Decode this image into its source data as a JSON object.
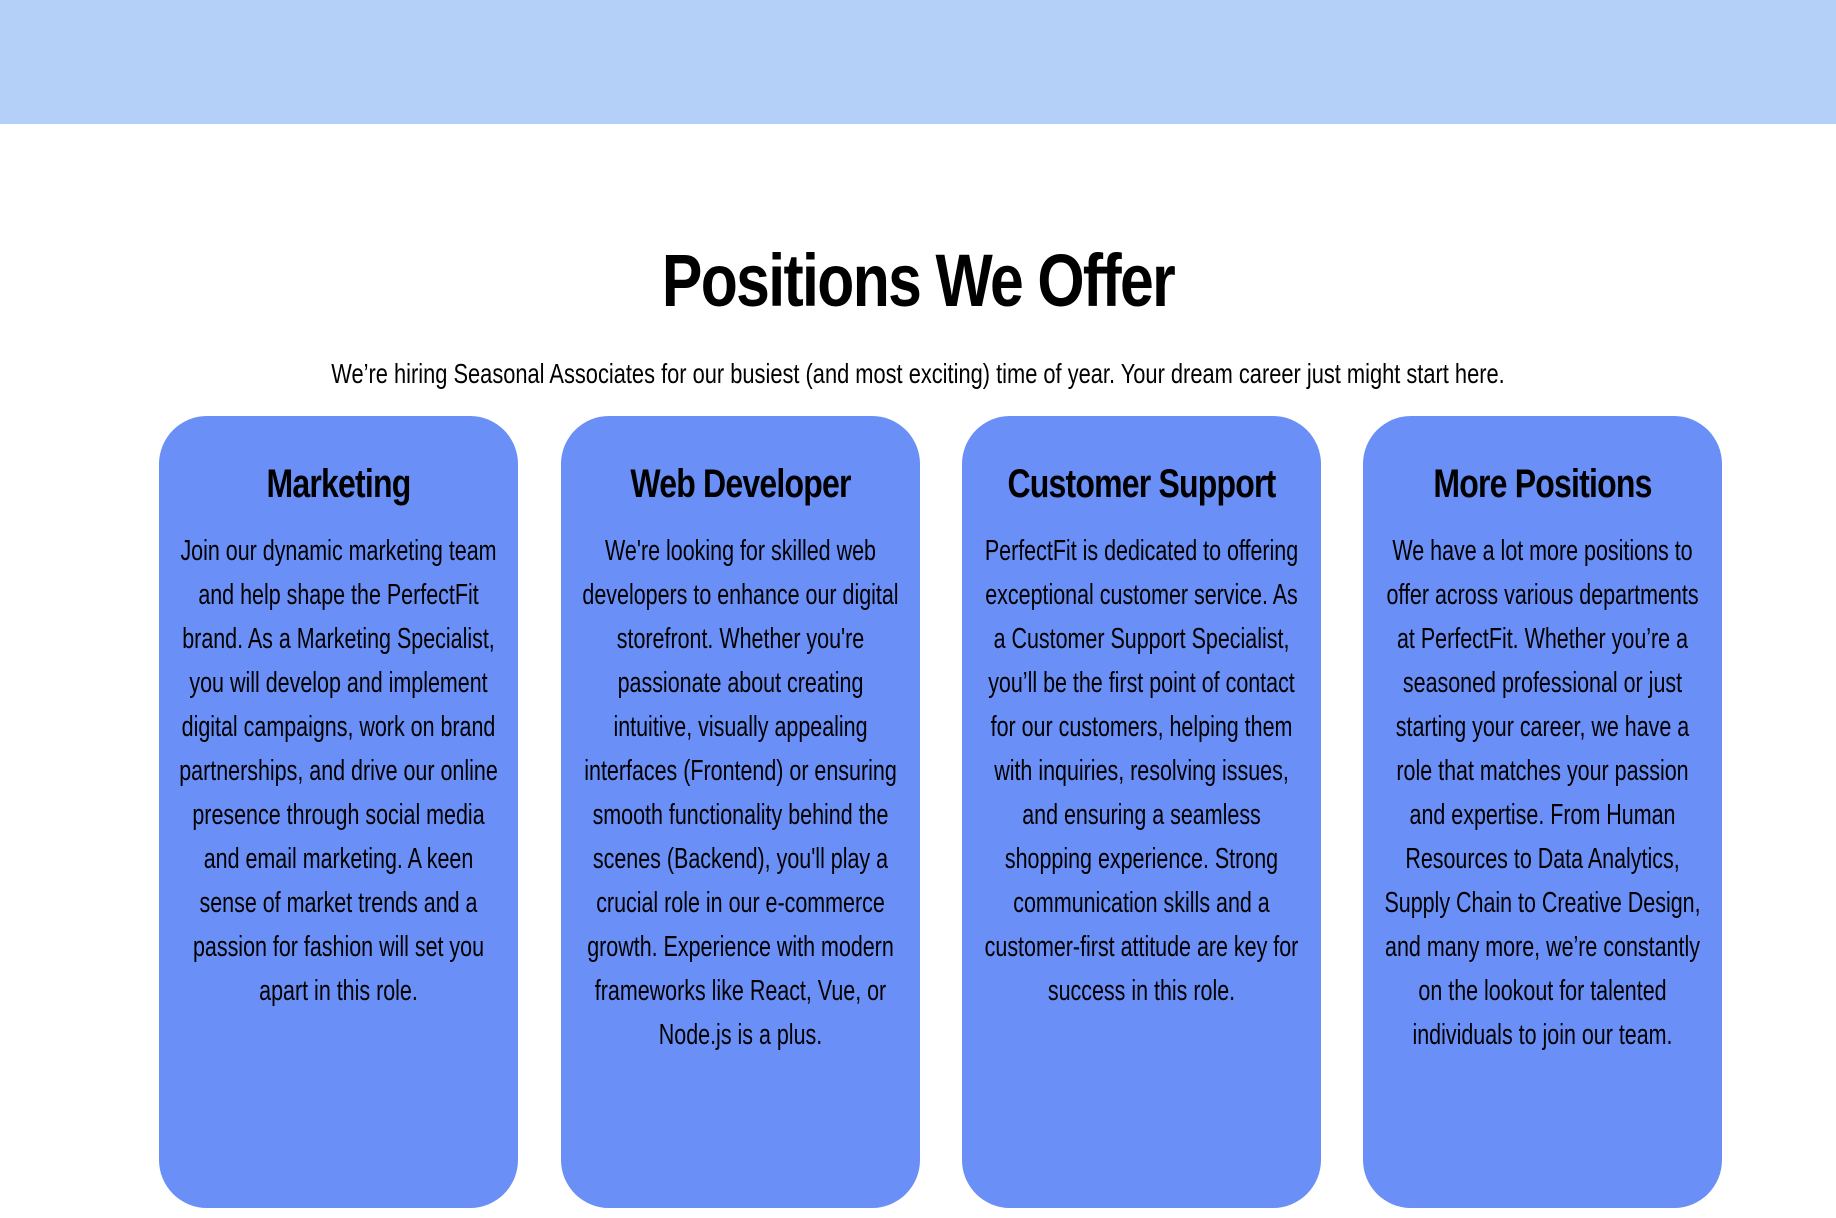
{
  "header": {
    "color": "#b5d0f8"
  },
  "positions": {
    "title": "Positions We Offer",
    "subtitle": "We’re hiring Seasonal Associates for our busiest (and most exciting) time of year. Your dream career just might start here.",
    "card_color": "#6a8ff6",
    "cards": [
      {
        "title": "Marketing",
        "body": "Join our dynamic marketing team and help shape the PerfectFit brand. As a Marketing Specialist, you will develop and implement digital campaigns, work on brand partnerships, and drive our online presence through social media and email marketing. A keen sense of market trends and a passion for fashion will set you apart in this role."
      },
      {
        "title": "Web Developer",
        "body": "We're looking for skilled web developers to enhance our digital storefront. Whether you're passionate about creating intuitive, visually appealing interfaces (Frontend) or ensuring smooth functionality behind the scenes (Backend), you'll play a crucial role in our e-commerce growth. Experience with modern frameworks like React, Vue, or Node.js is a plus."
      },
      {
        "title": "Customer Support",
        "body": "PerfectFit is dedicated to offering exceptional customer service. As a Customer Support Specialist, you’ll be the first point of contact for our customers, helping them with inquiries, resolving issues, and ensuring a seamless shopping experience. Strong communication skills and a customer-first attitude are key for success in this role."
      },
      {
        "title": "More Positions",
        "body": "We have a lot more positions to offer across various departments at PerfectFit. Whether you’re a seasoned professional or just starting your career, we have a role that matches your passion and expertise. From Human Resources to Data Analytics, Supply Chain to Creative Design, and many more, we’re constantly on the lookout for talented individuals to join our team."
      }
    ]
  }
}
